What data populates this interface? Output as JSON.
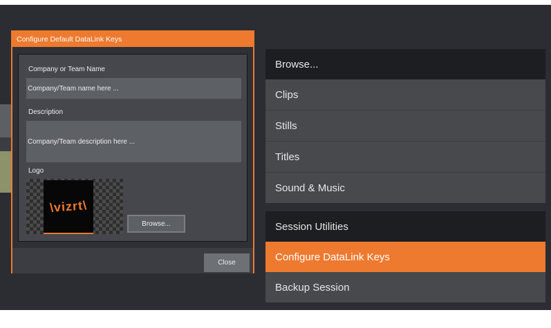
{
  "dialog": {
    "title": "Configure Default DataLink Keys",
    "company_label": "Company or Team Name",
    "company_value": "Company/Team name here ...",
    "description_label": "Description",
    "description_value": "Company/Team description here ...",
    "logo_label": "Logo",
    "logo_text": "\\vizrt\\",
    "browse_label": "Browse...",
    "close_label": "Close"
  },
  "menu": {
    "browse_header": "Browse...",
    "browse_items": [
      {
        "label": "Clips"
      },
      {
        "label": "Stills"
      },
      {
        "label": "Titles"
      },
      {
        "label": "Sound & Music"
      }
    ],
    "session_header": "Session Utilities",
    "session_items": [
      {
        "label": "Configure DataLink Keys",
        "active": true
      },
      {
        "label": "Backup Session",
        "active": false
      }
    ]
  },
  "colors": {
    "accent": "#ee7a2f",
    "background": "#2b2d32",
    "menu_item": "#47494d",
    "menu_header": "#1d1e22"
  }
}
